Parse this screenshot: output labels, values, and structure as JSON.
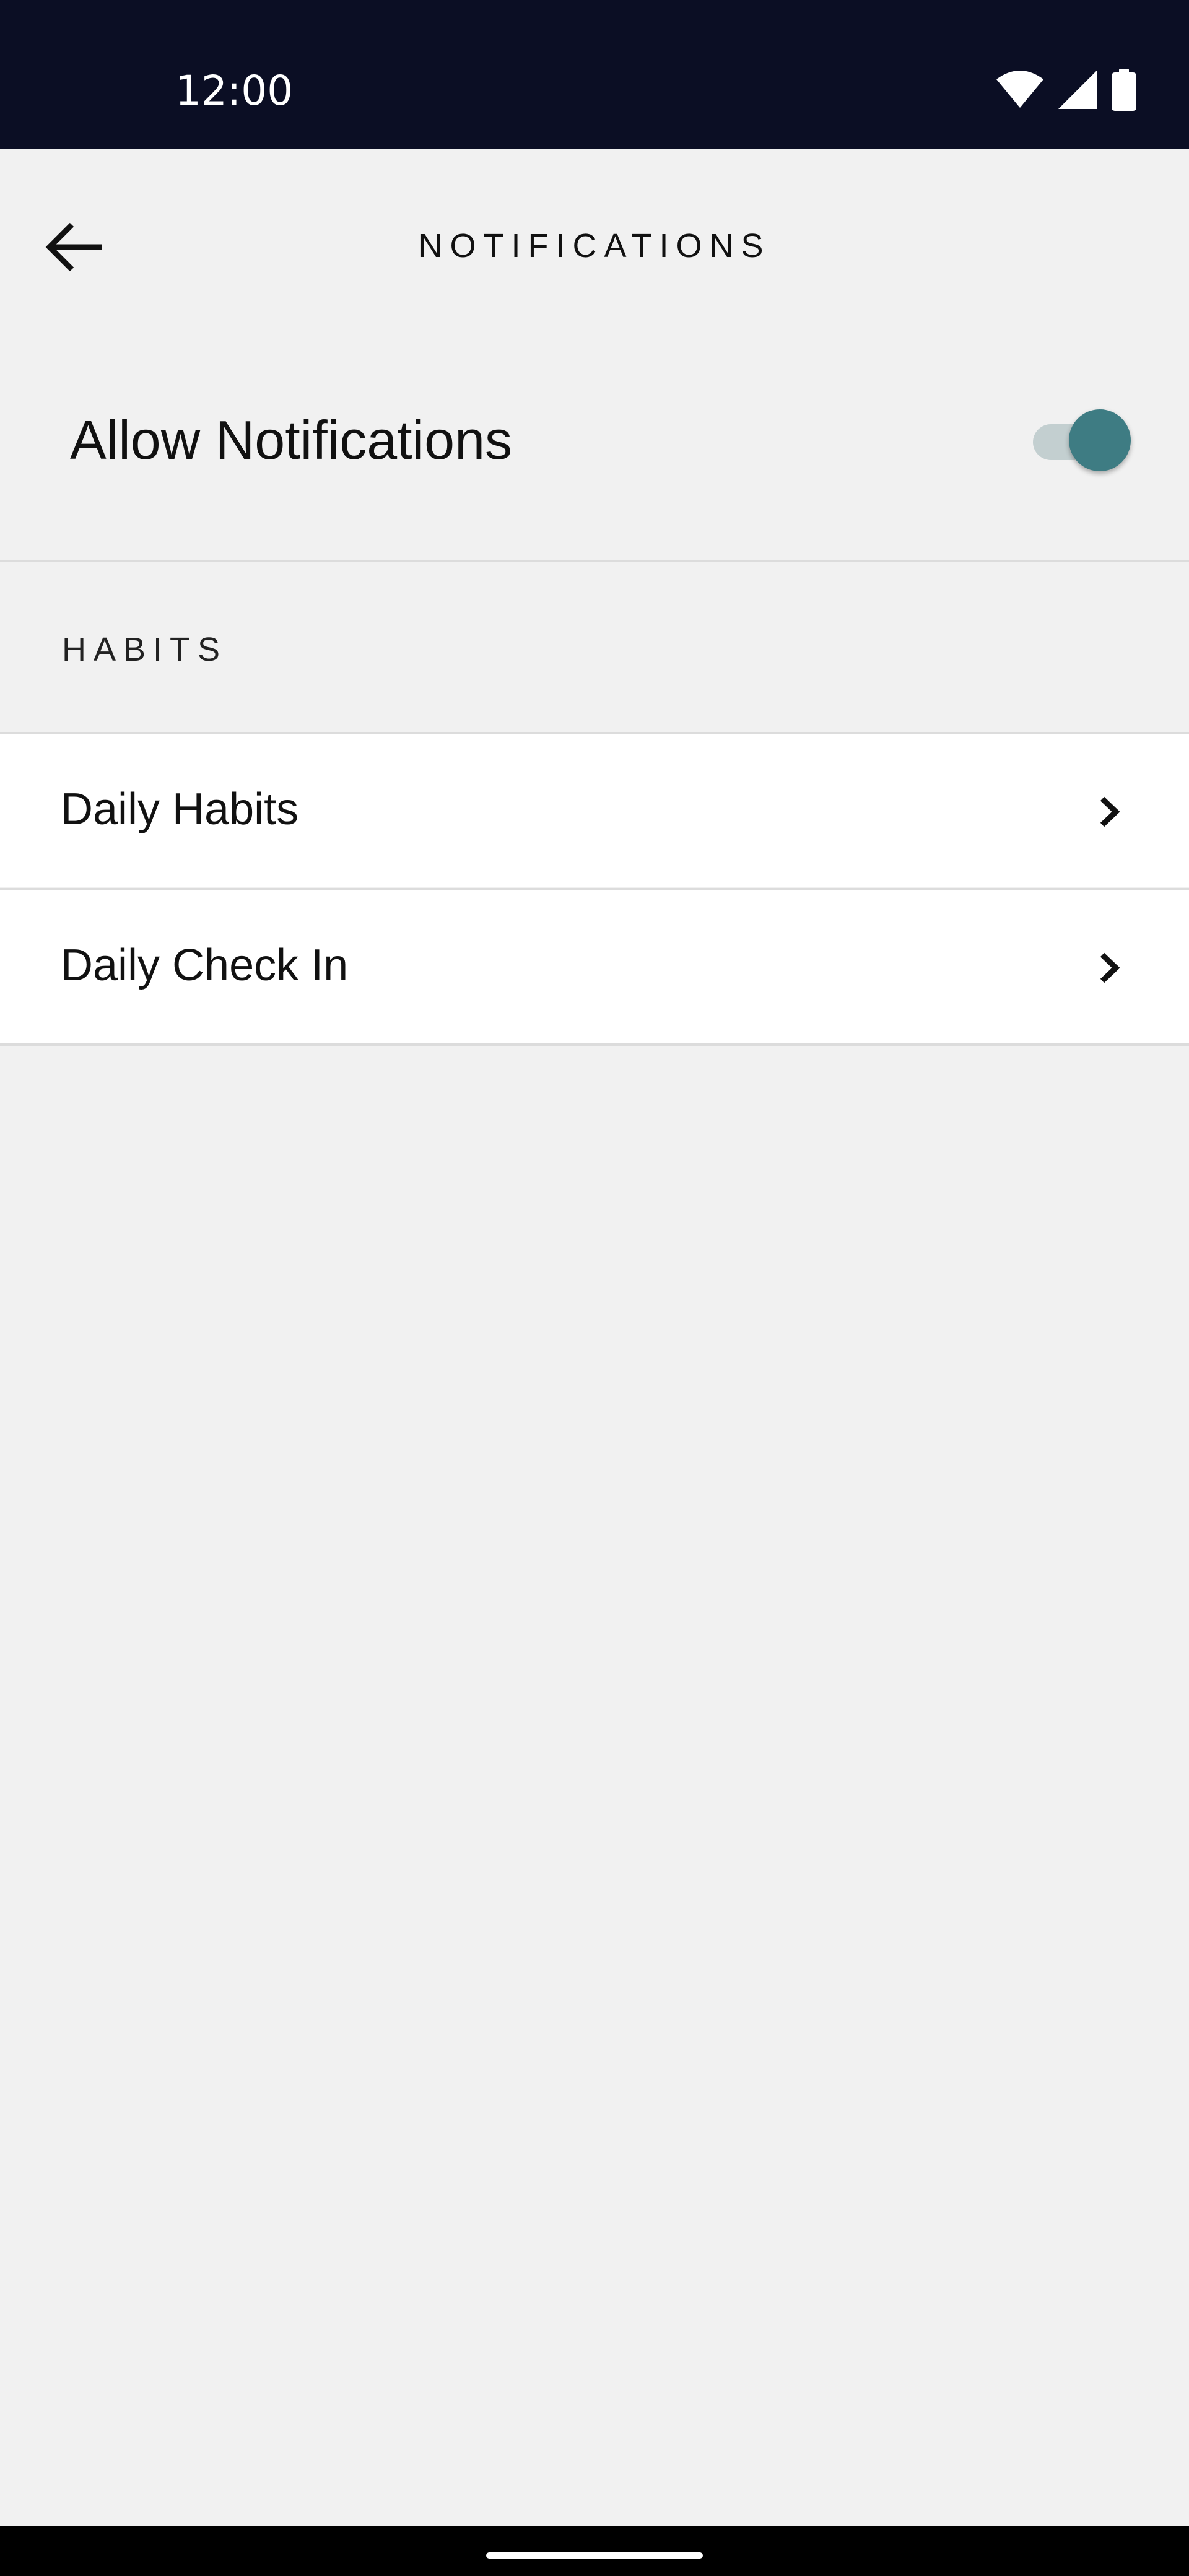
{
  "status_bar": {
    "time": "12:00",
    "icons": [
      "wifi-icon",
      "cellular-signal-icon",
      "battery-icon"
    ],
    "background": "#0b0e24"
  },
  "app_bar": {
    "title": "NOTIFICATIONS",
    "back_icon": "arrow-left-icon"
  },
  "allow_notifications": {
    "label": "Allow Notifications",
    "enabled": true,
    "accent": "#3e7c83"
  },
  "habits_section": {
    "header": "HABITS",
    "items": [
      {
        "label": "Daily Habits",
        "icon": "chevron-right-icon"
      },
      {
        "label": "Daily Check In",
        "icon": "chevron-right-icon"
      }
    ]
  }
}
